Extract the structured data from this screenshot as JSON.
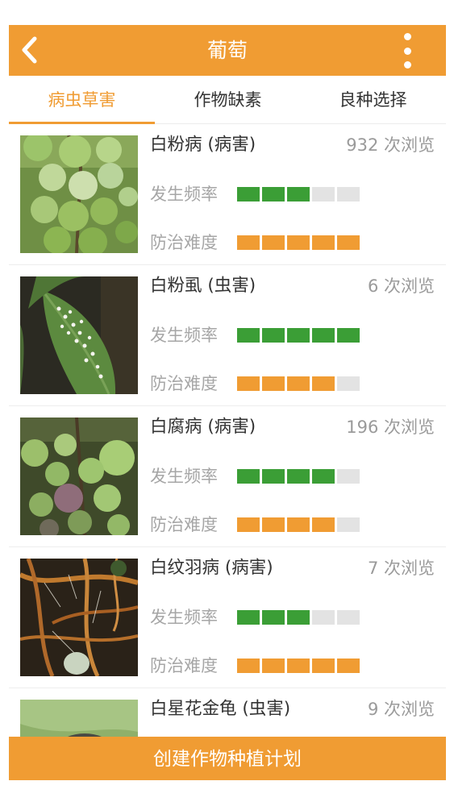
{
  "header": {
    "title": "葡萄",
    "back_icon": "chevron-left-icon",
    "more_icon": "more-vertical-icon"
  },
  "tabs": [
    {
      "label": "病虫草害",
      "active": true
    },
    {
      "label": "作物缺素",
      "active": false
    },
    {
      "label": "良种选择",
      "active": false
    }
  ],
  "list": {
    "frequency_label": "发生频率",
    "difficulty_label": "防治难度",
    "items": [
      {
        "name": "白粉病 (病害)",
        "views": "932 次浏览",
        "frequency": 3,
        "difficulty": 5,
        "image": "grape-powdery-mildew-photo"
      },
      {
        "name": "白粉虱 (虫害)",
        "views": "6 次浏览",
        "frequency": 5,
        "difficulty": 4,
        "image": "whitefly-leaf-photo"
      },
      {
        "name": "白腐病 (病害)",
        "views": "196 次浏览",
        "frequency": 4,
        "difficulty": 4,
        "image": "grape-white-rot-photo"
      },
      {
        "name": "白纹羽病 (病害)",
        "views": "7 次浏览",
        "frequency": 3,
        "difficulty": 5,
        "image": "root-rot-photo"
      },
      {
        "name": "白星花金龟 (虫害)",
        "views": "9 次浏览",
        "frequency": 0,
        "difficulty": 0,
        "image": "beetle-photo"
      }
    ],
    "max_level": 5
  },
  "footer": {
    "create_label": "创建作物种植计划"
  },
  "colors": {
    "accent": "#f09c33",
    "frequency_on": "#3b9e36",
    "difficulty_on": "#f09c33",
    "segment_off": "#e3e3e3"
  }
}
